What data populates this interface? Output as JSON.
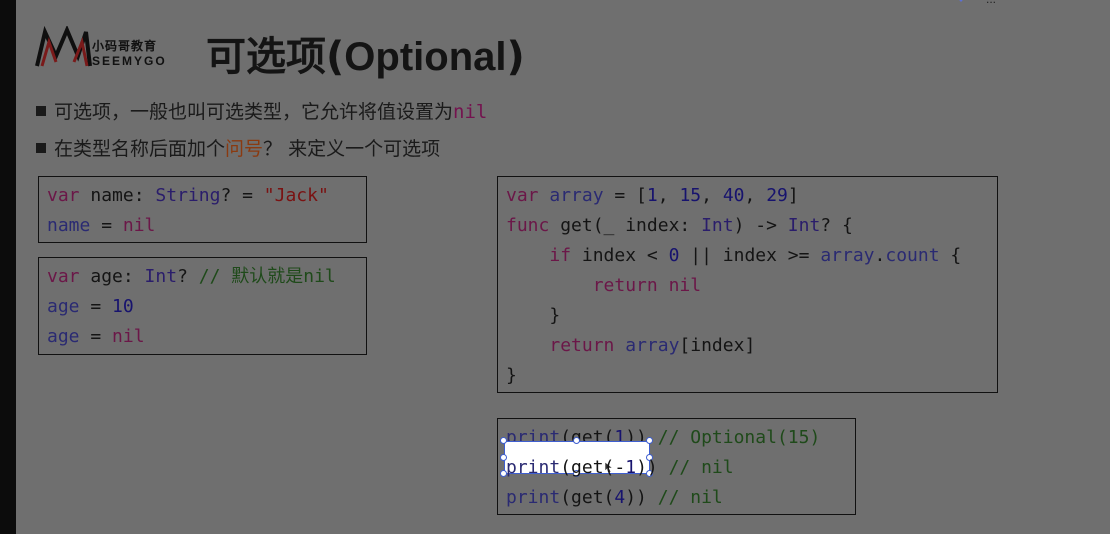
{
  "header": {
    "logo": {
      "cn": "小码哥教育",
      "en": "SEEMYGO",
      "mark_icon": "mountain-logo-icon"
    },
    "title": {
      "cn": "可选项",
      "open": "(",
      "en": "Optional",
      "close": ")"
    }
  },
  "top_right": {
    "text": "..."
  },
  "bullets": [
    {
      "prefix": "可选项，一般也叫可选类型，它允许将值设置为",
      "code": "nil"
    },
    {
      "prefix": "在类型名称后面加个",
      "highlight": "问号",
      "suffix": "？ 来定义一个可选项"
    }
  ],
  "code_blocks": {
    "block1": [
      [
        "var",
        " ",
        "name",
        ": ",
        "String",
        "? = ",
        "\"Jack\""
      ],
      [
        "name",
        " = ",
        "nil"
      ]
    ],
    "block2": [
      [
        "var",
        " age: ",
        "Int",
        "? ",
        "// 默认就是nil"
      ],
      [
        "age",
        " = ",
        "10"
      ],
      [
        "age",
        " = ",
        "nil"
      ]
    ],
    "block3": [
      [
        "var",
        " ",
        "array",
        " = [",
        "1",
        ", ",
        "15",
        ", ",
        "40",
        ", ",
        "29",
        "]"
      ],
      [
        "func",
        " get(_ index: ",
        "Int",
        ") -> ",
        "Int",
        "? {"
      ],
      [
        "    ",
        "if",
        " index < ",
        "0",
        " || index >= ",
        "array",
        ".",
        "count",
        " {"
      ],
      [
        "        ",
        "return",
        " ",
        "nil"
      ],
      [
        "    }"
      ],
      [
        "    ",
        "return",
        " ",
        "array",
        "[index]"
      ],
      [
        "}"
      ]
    ],
    "block4": [
      [
        "print",
        "(get(",
        "1",
        ")) ",
        "// Optional(15)"
      ],
      [
        "print",
        "(get(-",
        "1",
        ")) ",
        "// nil"
      ],
      [
        "print",
        "(get(",
        "4",
        ")) ",
        "// nil"
      ]
    ]
  },
  "selection": {
    "active": true
  }
}
